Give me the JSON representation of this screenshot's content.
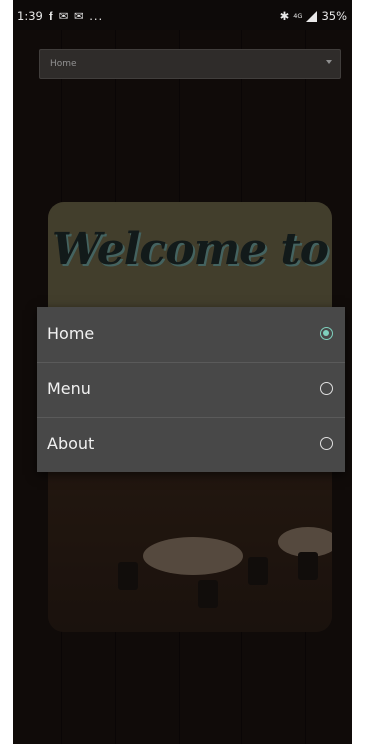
{
  "status_bar": {
    "time": "1:39",
    "icons": [
      "facebook-icon",
      "mail-icon",
      "mail-icon",
      "..."
    ],
    "network": "4G",
    "battery": "35%"
  },
  "dropdown": {
    "selected": "Home"
  },
  "hero": {
    "title": "Welcome to"
  },
  "menu": {
    "items": [
      {
        "label": "Home",
        "selected": true
      },
      {
        "label": "Menu",
        "selected": false
      },
      {
        "label": "About",
        "selected": false
      }
    ]
  },
  "colors": {
    "accent": "#7fd1be",
    "menu_bg": "#484848",
    "app_bg": "#1b1210"
  }
}
